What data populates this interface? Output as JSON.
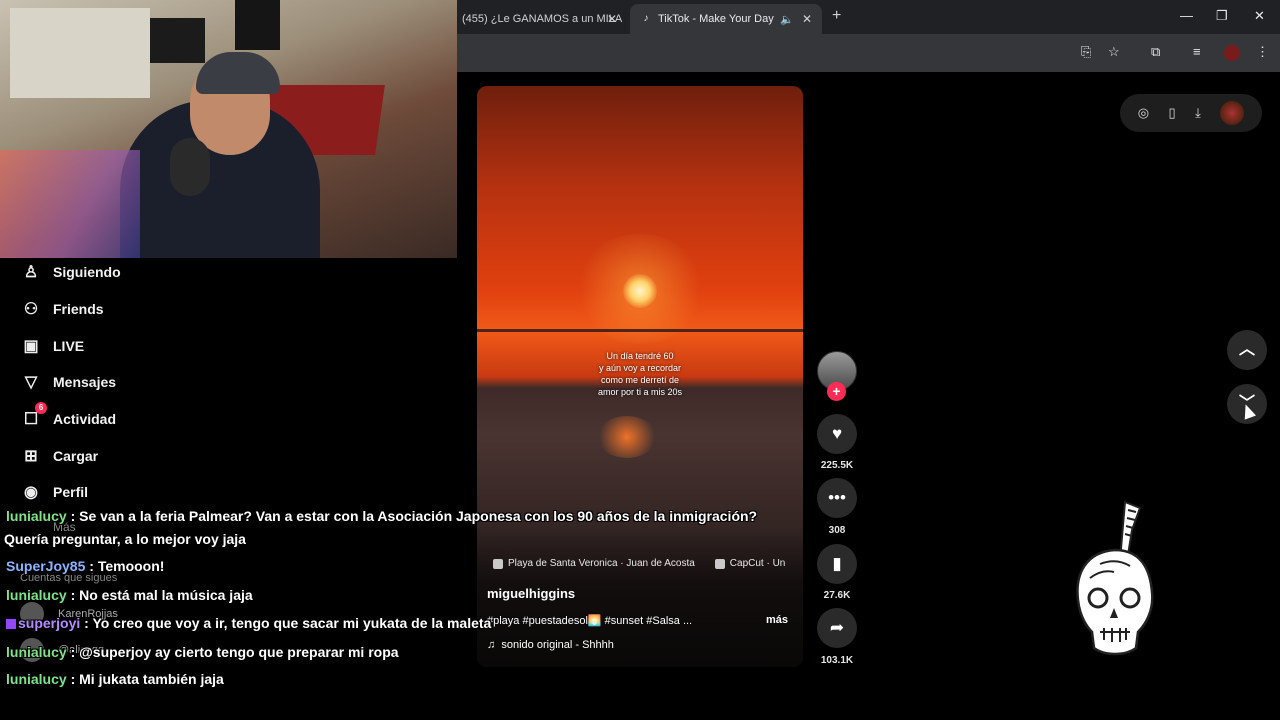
{
  "browser": {
    "tabs": [
      {
        "title": "(455) ¿Le GANAMOS a un MILA",
        "active": false
      },
      {
        "title": "TikTok - Make Your Day",
        "active": true
      }
    ],
    "new_tab": "+",
    "window_controls": {
      "minimize": "—",
      "restore": "❐",
      "close": "✕"
    }
  },
  "sidebar": {
    "items": [
      {
        "label": "Siguiendo",
        "icon": "following-icon"
      },
      {
        "label": "Friends",
        "icon": "friends-icon"
      },
      {
        "label": "LIVE",
        "icon": "live-icon"
      },
      {
        "label": "Mensajes",
        "icon": "messages-icon"
      },
      {
        "label": "Actividad",
        "icon": "activity-icon",
        "badge": "6"
      },
      {
        "label": "Cargar",
        "icon": "upload-icon"
      },
      {
        "label": "Perfil",
        "icon": "profile-icon"
      }
    ],
    "more": "Más",
    "following_accounts_title": "Cuentas que sigues",
    "accounts": [
      {
        "name": "KarenRojjas"
      },
      {
        "name": "@alicegg",
        "sub": "5121781670505alicegg"
      }
    ]
  },
  "video": {
    "caption": "Un día tendré 60\ny aún voy a recordar\ncomo me derretí de\namor por ti a mis 20s",
    "location": "Playa de Santa Veronica · Juan de Acosta",
    "capcut": "CapCut · Un",
    "author": "miguelhiggins",
    "hashtags": "#playa #puestadesol🌅 #sunset #Salsa ...",
    "more": "más",
    "sound": "sonido original - Shhhh"
  },
  "actions": {
    "likes": "225.5K",
    "comments": "308",
    "saves": "27.6K",
    "shares": "103.1K"
  },
  "chat": [
    {
      "user": "lunialucy",
      "color": "#7de38a",
      "text": ": Se van a la feria Palmear? Van a estar con la Asociación Japonesa con los 90 años de la inmigración?"
    },
    {
      "user": "",
      "color": "",
      "text": "Quería preguntar, a lo mejor voy jaja"
    },
    {
      "user": "SuperJoy85",
      "color": "#8ab4ff",
      "text": ": Temooon!"
    },
    {
      "user": "lunialucy",
      "color": "#7de38a",
      "text": ": No está mal la música jaja"
    },
    {
      "user": "superjoyi",
      "color": "#b48cff",
      "text": ": Yo creo que voy a ir, tengo que sacar mi yukata de la maleta"
    },
    {
      "user": "lunialucy",
      "color": "#7de38a",
      "text": ": @superjoy ay cierto tengo que preparar mi ropa"
    },
    {
      "user": "lunialucy",
      "color": "#7de38a",
      "text": ": Mi jukata también jaja"
    }
  ]
}
